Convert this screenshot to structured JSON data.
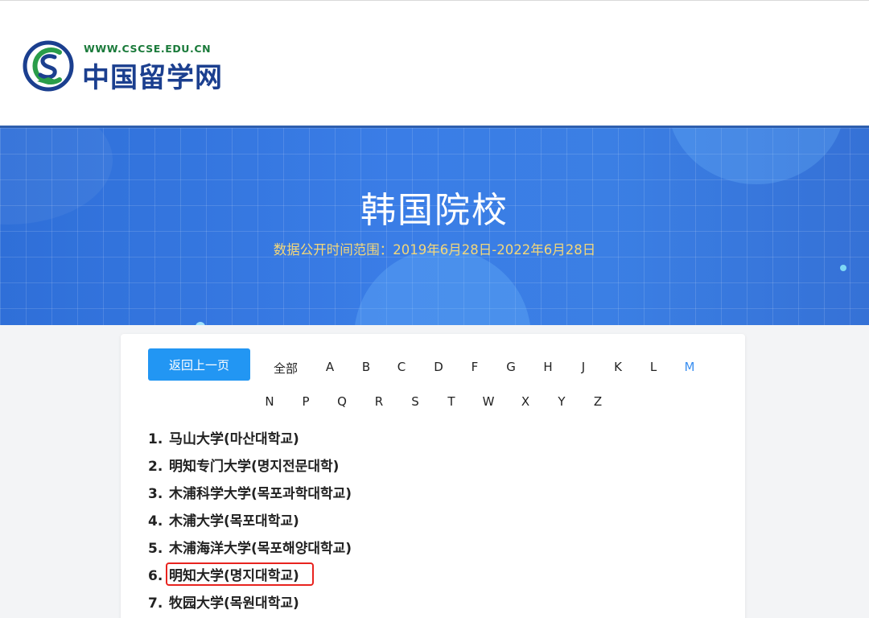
{
  "header": {
    "site_url": "WWW.CSCSE.EDU.CN",
    "site_name": "中国留学网",
    "logo_icon": "cscse-logo-icon"
  },
  "banner": {
    "title": "韩国院校",
    "subtitle": "数据公开时间范围：2019年6月28日-2022年6月28日"
  },
  "nav": {
    "back_label": "返回上一页",
    "letters_row1": [
      "全部",
      "A",
      "B",
      "C",
      "D",
      "F",
      "G",
      "H",
      "J",
      "K",
      "L",
      "M"
    ],
    "letters_row2": [
      "N",
      "P",
      "Q",
      "R",
      "S",
      "T",
      "W",
      "X",
      "Y",
      "Z"
    ],
    "active_letter": "M"
  },
  "universities": [
    {
      "num": "1.",
      "name": "马山大学(마산대학교)"
    },
    {
      "num": "2.",
      "name": "明知专门大学(명지전문대학)"
    },
    {
      "num": "3.",
      "name": "木浦科学大学(목포과학대학교)"
    },
    {
      "num": "4.",
      "name": "木浦大学(목포대학교)"
    },
    {
      "num": "5.",
      "name": "木浦海洋大学(목포해양대학교)"
    },
    {
      "num": "6.",
      "name": "明知大学(명지대학교)",
      "highlighted": true
    },
    {
      "num": "7.",
      "name": "牧园大学(목원대학교)"
    }
  ],
  "colors": {
    "accent": "#2296f3",
    "active_letter": "#3b8ff0",
    "highlight_box": "#e8231f",
    "subtitle": "#f3d77a"
  }
}
